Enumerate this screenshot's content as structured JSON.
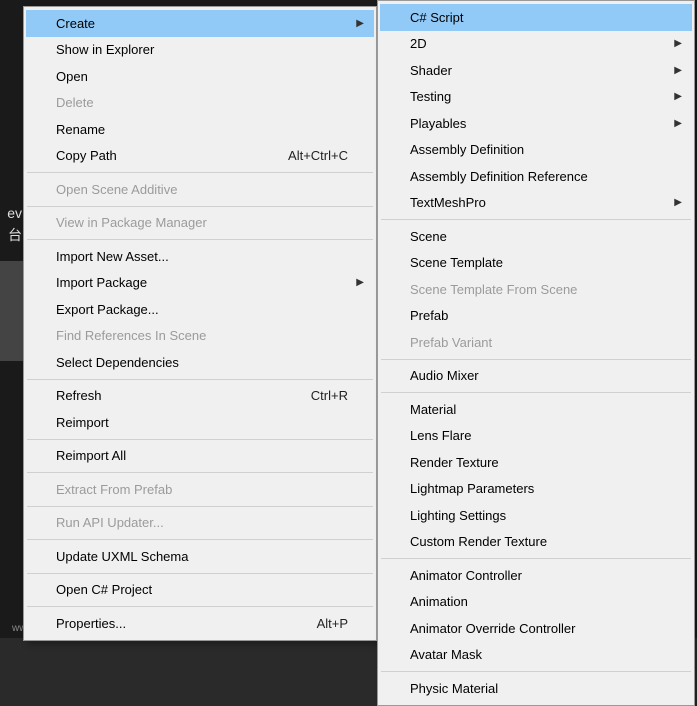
{
  "background": {
    "partial_text_1": "ev",
    "partial_text_2": "台",
    "watermark": "www.toymoban.com 网络图片仅供展示，非存储。如有侵权请联系删除"
  },
  "main_menu": {
    "items": [
      {
        "label": "Create",
        "has_submenu": true,
        "highlight": true
      },
      {
        "label": "Show in Explorer"
      },
      {
        "label": "Open"
      },
      {
        "label": "Delete",
        "disabled": true
      },
      {
        "label": "Rename"
      },
      {
        "label": "Copy Path",
        "shortcut": "Alt+Ctrl+C"
      },
      {
        "separator": true
      },
      {
        "label": "Open Scene Additive",
        "disabled": true
      },
      {
        "separator": true
      },
      {
        "label": "View in Package Manager",
        "disabled": true
      },
      {
        "separator": true
      },
      {
        "label": "Import New Asset..."
      },
      {
        "label": "Import Package",
        "has_submenu": true
      },
      {
        "label": "Export Package..."
      },
      {
        "label": "Find References In Scene",
        "disabled": true
      },
      {
        "label": "Select Dependencies"
      },
      {
        "separator": true
      },
      {
        "label": "Refresh",
        "shortcut": "Ctrl+R"
      },
      {
        "label": "Reimport"
      },
      {
        "separator": true
      },
      {
        "label": "Reimport All"
      },
      {
        "separator": true
      },
      {
        "label": "Extract From Prefab",
        "disabled": true
      },
      {
        "separator": true
      },
      {
        "label": "Run API Updater...",
        "disabled": true
      },
      {
        "separator": true
      },
      {
        "label": "Update UXML Schema"
      },
      {
        "separator": true
      },
      {
        "label": "Open C# Project"
      },
      {
        "separator": true
      },
      {
        "label": "Properties...",
        "shortcut": "Alt+P"
      }
    ]
  },
  "sub_menu": {
    "items": [
      {
        "label": "C# Script",
        "highlight": true
      },
      {
        "label": "2D",
        "has_submenu": true
      },
      {
        "label": "Shader",
        "has_submenu": true
      },
      {
        "label": "Testing",
        "has_submenu": true
      },
      {
        "label": "Playables",
        "has_submenu": true
      },
      {
        "label": "Assembly Definition"
      },
      {
        "label": "Assembly Definition Reference"
      },
      {
        "label": "TextMeshPro",
        "has_submenu": true
      },
      {
        "separator": true
      },
      {
        "label": "Scene"
      },
      {
        "label": "Scene Template"
      },
      {
        "label": "Scene Template From Scene",
        "disabled": true
      },
      {
        "label": "Prefab"
      },
      {
        "label": "Prefab Variant",
        "disabled": true
      },
      {
        "separator": true
      },
      {
        "label": "Audio Mixer"
      },
      {
        "separator": true
      },
      {
        "label": "Material"
      },
      {
        "label": "Lens Flare"
      },
      {
        "label": "Render Texture"
      },
      {
        "label": "Lightmap Parameters"
      },
      {
        "label": "Lighting Settings"
      },
      {
        "label": "Custom Render Texture"
      },
      {
        "separator": true
      },
      {
        "label": "Animator Controller"
      },
      {
        "label": "Animation"
      },
      {
        "label": "Animator Override Controller"
      },
      {
        "label": "Avatar Mask"
      },
      {
        "separator": true
      },
      {
        "label": "Physic Material"
      }
    ]
  }
}
